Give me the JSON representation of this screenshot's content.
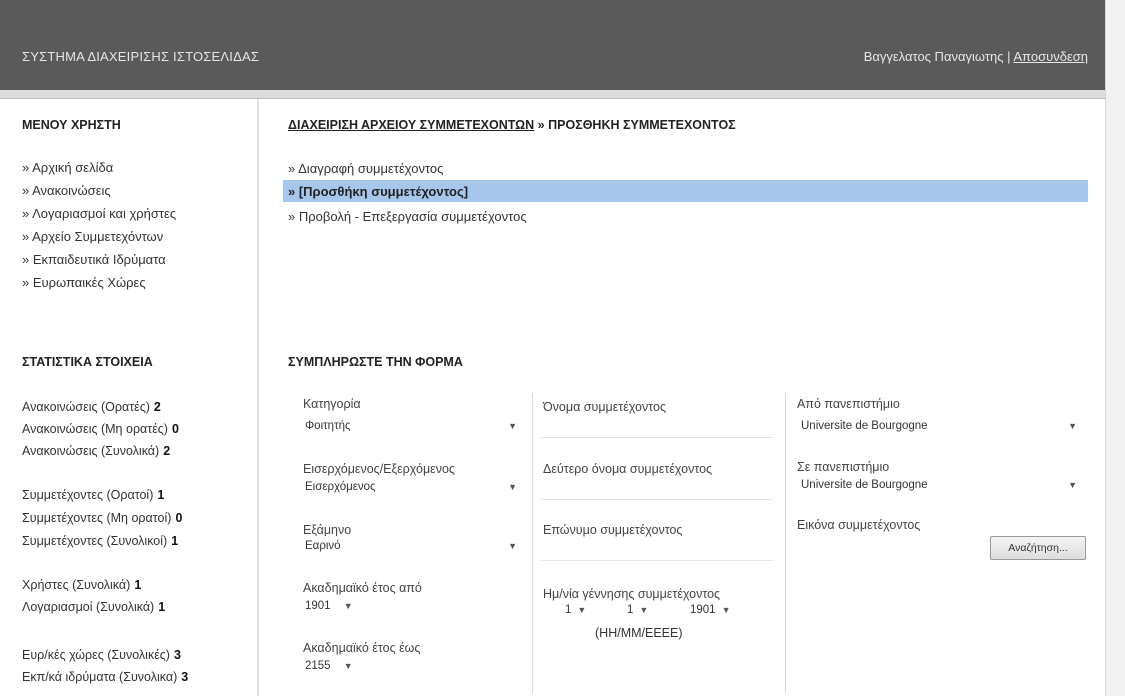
{
  "header": {
    "app_title": "ΣΥΣΤΗΜΑ ΔΙΑΧΕΙΡΙΣΗΣ ΙΣΤΟΣΕΛΙΔΑΣ",
    "user_name": "Βαγγελατος Παναγιωτης",
    "separator": "|",
    "logout_label": "Αποσυνδεση"
  },
  "sidebar": {
    "menu_heading": "ΜΕΝΟΥ ΧΡΗΣΤΗ",
    "menu_items": [
      "» Αρχική σελίδα",
      "» Ανακοινώσεις",
      "» Λογαριασμοί και χρήστες",
      "» Αρχείο Συμμετεχόντων",
      "» Εκπαιδευτικά Ιδρύματα",
      "» Ευρωπαικές Χώρες"
    ],
    "stats_heading": "ΣΤΑΤΙΣΤΙΚΑ ΣΤΟΙΧΕΙΑ",
    "stats": [
      {
        "label": "Ανακοινώσεις (Ορατές)",
        "value": "2"
      },
      {
        "label": "Ανακοινώσεις (Μη ορατές)",
        "value": "0"
      },
      {
        "label": "Ανακοινώσεις (Συνολικά)",
        "value": "2"
      },
      {
        "label": "Συμμετέχοντες (Ορατοί)",
        "value": "1"
      },
      {
        "label": "Συμμετέχοντες (Μη ορατοί)",
        "value": "0"
      },
      {
        "label": "Συμμετέχοντες (Συνολικοί)",
        "value": "1"
      },
      {
        "label": "Χρήστες (Συνολικά)",
        "value": "1"
      },
      {
        "label": "Λογαριασμοί (Συνολικά)",
        "value": "1"
      },
      {
        "label": "Ευρ/κές χώρες (Συνολικές)",
        "value": "3"
      },
      {
        "label": "Εκπ/κά ιδρύματα (Συνολικα)",
        "value": "3"
      }
    ]
  },
  "breadcrumb": {
    "parent": "ΔΙΑΧΕΙΡΙΣΗ ΑΡΧΕΙΟΥ ΣΥΜΜΕΤΕΧΟΝΤΩΝ",
    "separator": " » ",
    "current": "ΠΡΟΣΘΗΚΗ ΣΥΜΜΕΤΕΧΟΝΤΟΣ"
  },
  "actions": {
    "delete": "» Διαγραφή συμμετέχοντος",
    "add_selected": "» [Προσθήκη συμμετέχοντος]",
    "view_edit": "» Προβολή - Επεξεργασία συμμετέχοντος"
  },
  "form": {
    "heading": "ΣΥΜΠΛΗΡΩΣΤΕ ΤΗΝ ΦΟΡΜΑ",
    "category_label": "Κατηγορία",
    "category_value": "Φοιτητής",
    "direction_label": "Εισερχόμενος/Εξερχόμενος",
    "direction_value": "Εισερχόμενος",
    "semester_label": "Εξάμηνο",
    "semester_value": "Εαρινό",
    "year_from_label": "Ακαδημαϊκό έτος από",
    "year_from_value": "1901",
    "year_to_label": "Ακαδημαϊκό έτος έως",
    "year_to_value": "2155",
    "first_name_label": "Όνομα συμμετέχοντος",
    "middle_name_label": "Δεύτερο όνομα συμμετέχοντος",
    "last_name_label": "Επώνυμο συμμετέχοντος",
    "birthdate_label": "Ημ/νία γέννησης συμμετέχοντος",
    "birth_day": "1",
    "birth_month": "1",
    "birth_year": "1901",
    "date_format": "(ΗΗ/ΜΜ/ΕΕΕΕ)",
    "from_univ_label": "Από πανεπιστήμιο",
    "from_univ_value": "Universite de Bourgogne",
    "to_univ_label": "Σε πανεπιστήμιο",
    "to_univ_value": "Universite de Bourgogne",
    "image_label": "Εικόνα συμμετέχοντος",
    "browse_label": "Αναζήτηση..."
  },
  "icons": {
    "dropdown": "chevron-down-icon"
  }
}
